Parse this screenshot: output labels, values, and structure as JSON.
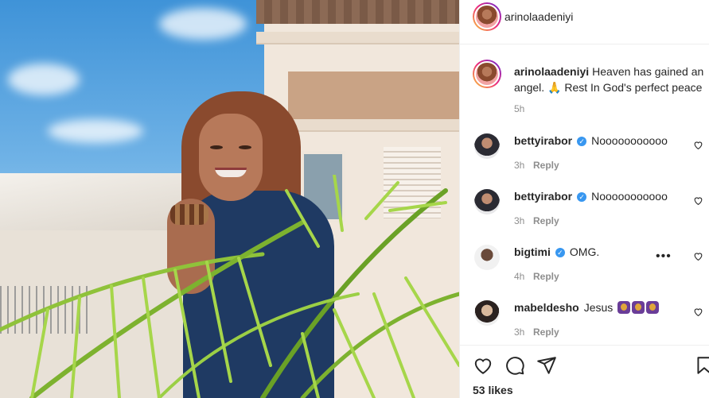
{
  "post": {
    "author": "arinolaadeniyi",
    "likes_text": "53 likes"
  },
  "caption": {
    "username": "arinolaadeniyi",
    "text": "Heaven has gained an angel. 🙏 Rest In God's perfect peace",
    "time": "5h"
  },
  "comments": [
    {
      "username": "bettyirabor",
      "verified": true,
      "text": "Nooooooooooo",
      "time": "3h",
      "reply": "Reply"
    },
    {
      "username": "bettyirabor",
      "verified": true,
      "text": "Nooooooooooo",
      "time": "3h",
      "reply": "Reply"
    },
    {
      "username": "bigtimi",
      "verified": true,
      "text": "OMG.",
      "time": "4h",
      "reply": "Reply"
    },
    {
      "username": "mabeldesho",
      "verified": false,
      "text": "Jesus",
      "time": "3h",
      "reply": "Reply"
    }
  ],
  "icons": {
    "like": "heart-icon",
    "comment": "comment-icon",
    "share": "share-icon",
    "save": "bookmark-icon",
    "verified": "verified-badge-icon",
    "more": "more-options-icon"
  },
  "colors": {
    "verified": "#3897f0",
    "muted": "#8e8e8e",
    "text": "#262626"
  }
}
